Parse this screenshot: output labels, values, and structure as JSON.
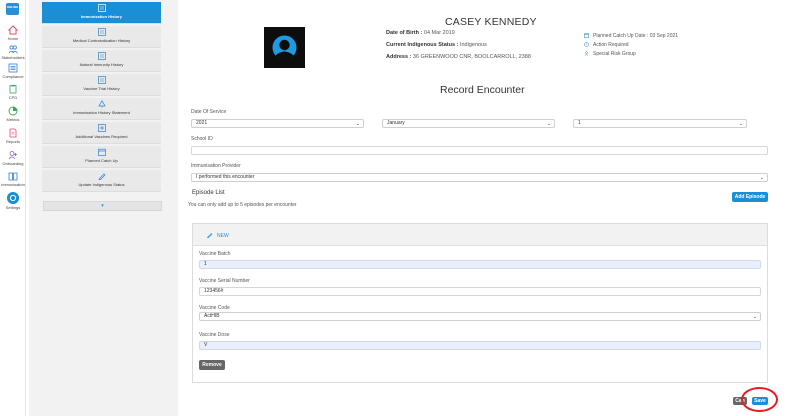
{
  "rail": {
    "logo": "ONLINE",
    "items": [
      {
        "label": "Home",
        "icon": "home-icon"
      },
      {
        "label": "Stakeholders",
        "icon": "users-icon"
      },
      {
        "label": "Compliance",
        "icon": "list-icon"
      },
      {
        "label": "CPD",
        "icon": "clipboard-icon"
      },
      {
        "label": "Metrics",
        "icon": "metrics-icon"
      },
      {
        "label": "Reports",
        "icon": "report-icon"
      },
      {
        "label": "Onboarding",
        "icon": "onboarding-icon"
      },
      {
        "label": "Immunisation",
        "icon": "book-icon"
      },
      {
        "label": "Settings",
        "icon": "gear-icon"
      }
    ]
  },
  "submenu": {
    "items": [
      {
        "label": "Immunisation History",
        "icon": "list-icon",
        "active": true
      },
      {
        "label": "Medical Contraindication History",
        "icon": "list-icon"
      },
      {
        "label": "Natural Immunity History",
        "icon": "list-icon"
      },
      {
        "label": "Vaccine Trial History",
        "icon": "list-icon"
      },
      {
        "label": "Immunisation History Statement",
        "icon": "tree-icon"
      },
      {
        "label": "Additional Vaccines Required",
        "icon": "plus-icon"
      },
      {
        "label": "Planned Catch Up",
        "icon": "calendar-icon"
      },
      {
        "label": "Update Indigenous Status",
        "icon": "pencil-icon"
      }
    ],
    "toggle": "▾"
  },
  "patient": {
    "name": "CASEY KENNEDY",
    "dob_label": "Date of Birth :",
    "dob": "04 Mar 2019",
    "indigenous_label": "Current Indigenous Status :",
    "indigenous": "Indigenous",
    "address_label": "Address :",
    "address": "36 GREENWOOD CNR, BOOLCARROLL, 2388",
    "planned_catch_up": "Planned Catch Up Date : 03 Sep 2021",
    "action_required": "Action Required",
    "special_risk": "Special Risk Group"
  },
  "form": {
    "title": "Record Encounter",
    "date_of_service_label": "Date Of Service",
    "year": "2021",
    "month": "January",
    "day": "1",
    "school_id_label": "School ID",
    "school_id": "",
    "provider_label": "Immunisation Provider",
    "provider": "I performed this encounter",
    "episode_list_label": "Episode List",
    "add_episode": "Add Episode",
    "episode_note": "You can only add up to 5 episodes per encounter"
  },
  "episode": {
    "tag": "NEW",
    "batch_label": "Vaccine Batch",
    "batch": "1",
    "serial_label": "Vaccine Serial Number",
    "serial": "123456#",
    "code_label": "Vaccine Code",
    "code": "ActHIB",
    "dose_label": "Vaccine Dose",
    "dose": "V",
    "remove": "Remove"
  },
  "footer": {
    "cancel": "Can",
    "save": "Save"
  },
  "colors": {
    "accent": "#1a8fd6",
    "highlight_ring": "#e41e1e"
  }
}
